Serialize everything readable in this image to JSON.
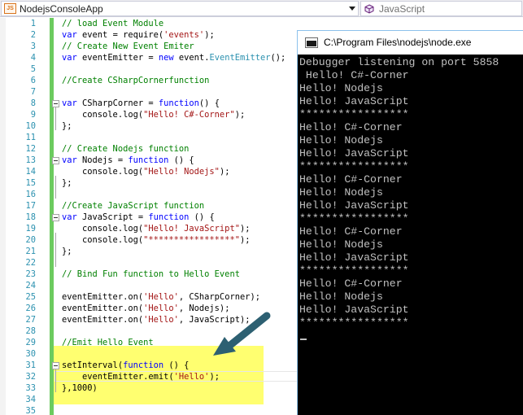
{
  "navbar": {
    "project_badge": "JS",
    "project_name": "NodejsConsoleApp",
    "scope_name": "JavaScript"
  },
  "editor": {
    "lines": [
      {
        "n": "1",
        "tokens": [
          {
            "t": "// load Event Module",
            "c": "comment"
          }
        ]
      },
      {
        "n": "2",
        "tokens": [
          {
            "t": "var",
            "c": "keyword"
          },
          {
            "t": " event = require(",
            "c": "plain"
          },
          {
            "t": "'events'",
            "c": "string"
          },
          {
            "t": ");",
            "c": "plain"
          }
        ]
      },
      {
        "n": "3",
        "tokens": [
          {
            "t": "// Create New Event Emiter",
            "c": "comment"
          }
        ]
      },
      {
        "n": "4",
        "tokens": [
          {
            "t": "var",
            "c": "keyword"
          },
          {
            "t": " eventEmitter = ",
            "c": "plain"
          },
          {
            "t": "new",
            "c": "keyword"
          },
          {
            "t": " event.",
            "c": "plain"
          },
          {
            "t": "EventEmitter",
            "c": "type"
          },
          {
            "t": "();",
            "c": "plain"
          }
        ]
      },
      {
        "n": "5",
        "tokens": []
      },
      {
        "n": "6",
        "tokens": [
          {
            "t": "//Create CSharpCornerfunction",
            "c": "comment"
          }
        ]
      },
      {
        "n": "7",
        "tokens": []
      },
      {
        "n": "8",
        "tokens": [
          {
            "t": "var",
            "c": "keyword"
          },
          {
            "t": " CSharpCorner = ",
            "c": "plain"
          },
          {
            "t": "function",
            "c": "keyword"
          },
          {
            "t": "() {",
            "c": "plain"
          }
        ]
      },
      {
        "n": "9",
        "tokens": [
          {
            "t": "    console.log(",
            "c": "plain"
          },
          {
            "t": "\"Hello! C#-Corner\"",
            "c": "string"
          },
          {
            "t": ");",
            "c": "plain"
          }
        ]
      },
      {
        "n": "10",
        "tokens": [
          {
            "t": "};",
            "c": "plain"
          }
        ]
      },
      {
        "n": "11",
        "tokens": []
      },
      {
        "n": "12",
        "tokens": [
          {
            "t": "// Create Nodejs function",
            "c": "comment"
          }
        ]
      },
      {
        "n": "13",
        "tokens": [
          {
            "t": "var",
            "c": "keyword"
          },
          {
            "t": " Nodejs = ",
            "c": "plain"
          },
          {
            "t": "function",
            "c": "keyword"
          },
          {
            "t": " () {",
            "c": "plain"
          }
        ]
      },
      {
        "n": "14",
        "tokens": [
          {
            "t": "    console.log(",
            "c": "plain"
          },
          {
            "t": "\"Hello! Nodejs\"",
            "c": "string"
          },
          {
            "t": ");",
            "c": "plain"
          }
        ]
      },
      {
        "n": "15",
        "tokens": [
          {
            "t": "};",
            "c": "plain"
          }
        ]
      },
      {
        "n": "16",
        "tokens": []
      },
      {
        "n": "17",
        "tokens": [
          {
            "t": "//Create JavaScript function",
            "c": "comment"
          }
        ]
      },
      {
        "n": "18",
        "tokens": [
          {
            "t": "var",
            "c": "keyword"
          },
          {
            "t": " JavaScript = ",
            "c": "plain"
          },
          {
            "t": "function",
            "c": "keyword"
          },
          {
            "t": " () {",
            "c": "plain"
          }
        ]
      },
      {
        "n": "19",
        "tokens": [
          {
            "t": "    console.log(",
            "c": "plain"
          },
          {
            "t": "\"Hello! JavaScript\"",
            "c": "string"
          },
          {
            "t": ");",
            "c": "plain"
          }
        ]
      },
      {
        "n": "20",
        "tokens": [
          {
            "t": "    console.log(",
            "c": "plain"
          },
          {
            "t": "\"*****************\"",
            "c": "string"
          },
          {
            "t": ");",
            "c": "plain"
          }
        ]
      },
      {
        "n": "21",
        "tokens": [
          {
            "t": "};",
            "c": "plain"
          }
        ]
      },
      {
        "n": "22",
        "tokens": []
      },
      {
        "n": "23",
        "tokens": [
          {
            "t": "// Bind Fun function to Hello Event",
            "c": "comment"
          }
        ]
      },
      {
        "n": "24",
        "tokens": []
      },
      {
        "n": "25",
        "tokens": [
          {
            "t": "eventEmitter.on(",
            "c": "plain"
          },
          {
            "t": "'Hello'",
            "c": "string"
          },
          {
            "t": ", CSharpCorner);",
            "c": "plain"
          }
        ]
      },
      {
        "n": "26",
        "tokens": [
          {
            "t": "eventEmitter.on(",
            "c": "plain"
          },
          {
            "t": "'Hello'",
            "c": "string"
          },
          {
            "t": ", Nodejs);",
            "c": "plain"
          }
        ]
      },
      {
        "n": "27",
        "tokens": [
          {
            "t": "eventEmitter.on(",
            "c": "plain"
          },
          {
            "t": "'Hello'",
            "c": "string"
          },
          {
            "t": ", JavaScript);",
            "c": "plain"
          }
        ]
      },
      {
        "n": "28",
        "tokens": []
      },
      {
        "n": "29",
        "tokens": [
          {
            "t": "//Emit Hello Event",
            "c": "comment"
          }
        ]
      },
      {
        "n": "30",
        "tokens": []
      },
      {
        "n": "31",
        "tokens": [
          {
            "t": "setInterval(",
            "c": "plain"
          },
          {
            "t": "function",
            "c": "keyword"
          },
          {
            "t": " () {",
            "c": "plain"
          }
        ]
      },
      {
        "n": "32",
        "tokens": [
          {
            "t": "    eventEmitter.emit(",
            "c": "plain"
          },
          {
            "t": "'Hello'",
            "c": "string"
          },
          {
            "t": ");",
            "c": "plain"
          }
        ]
      },
      {
        "n": "33",
        "tokens": [
          {
            "t": "},1000)",
            "c": "plain"
          }
        ]
      },
      {
        "n": "34",
        "tokens": []
      },
      {
        "n": "35",
        "tokens": []
      }
    ]
  },
  "console": {
    "title": "C:\\Program Files\\nodejs\\node.exe",
    "lines": [
      "Debugger listening on port 5858",
      " Hello! C#-Corner",
      "Hello! Nodejs",
      "Hello! JavaScript",
      "*****************",
      "Hello! C#-Corner",
      "Hello! Nodejs",
      "Hello! JavaScript",
      "*****************",
      "Hello! C#-Corner",
      "Hello! Nodejs",
      "Hello! JavaScript",
      "*****************",
      "Hello! C#-Corner",
      "Hello! Nodejs",
      "Hello! JavaScript",
      "*****************",
      "Hello! C#-Corner",
      "Hello! Nodejs",
      "Hello! JavaScript",
      "*****************"
    ]
  },
  "colors": {
    "comment": "#008000",
    "keyword": "#0000ff",
    "string": "#a31515",
    "type": "#2b91af",
    "line_number": "#2b91af",
    "change_bar": "#6ccb5f",
    "highlight": "#ffff57",
    "arrow": "#2d6072"
  }
}
